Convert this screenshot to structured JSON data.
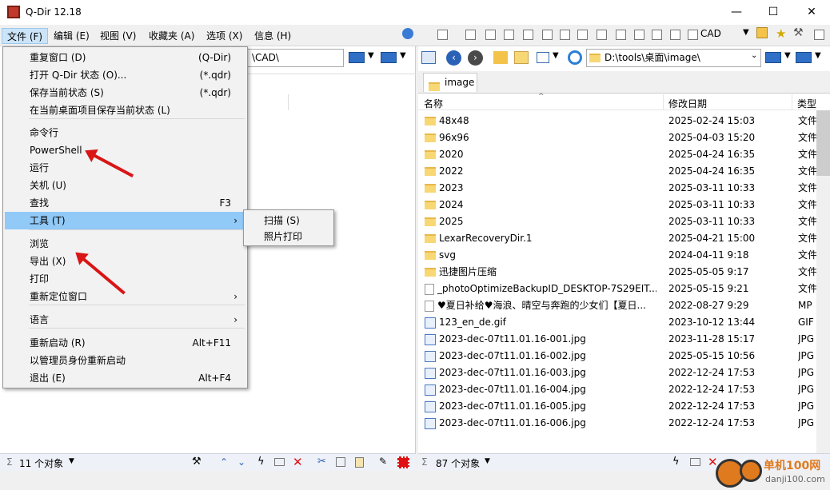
{
  "window": {
    "title": "Q-Dir 12.18",
    "minimize": "—",
    "maximize": "☐",
    "close": "✕"
  },
  "menubar": [
    "文件 (F)",
    "编辑 (E)",
    "视图 (V)",
    "收藏夹 (A)",
    "选项 (X)",
    "信息 (H)"
  ],
  "toolbar": {
    "cad_label": "CAD"
  },
  "left_pane": {
    "address": "\\CAD\\",
    "status": "11 个对象"
  },
  "right_pane": {
    "address": "D:\\tools\\桌面\\image\\",
    "tab": "image",
    "columns": {
      "name": "名称",
      "date": "修改日期",
      "type": "类型"
    },
    "status": "87 个对象",
    "rows": [
      {
        "icon": "folder",
        "name": "48x48",
        "date": "2025-02-24 15:03",
        "type": "文件"
      },
      {
        "icon": "folder",
        "name": "96x96",
        "date": "2025-04-03 15:20",
        "type": "文件"
      },
      {
        "icon": "folder",
        "name": "2020",
        "date": "2025-04-24 16:35",
        "type": "文件"
      },
      {
        "icon": "folder",
        "name": "2022",
        "date": "2025-04-24 16:35",
        "type": "文件"
      },
      {
        "icon": "folder",
        "name": "2023",
        "date": "2025-03-11 10:33",
        "type": "文件"
      },
      {
        "icon": "folder",
        "name": "2024",
        "date": "2025-03-11 10:33",
        "type": "文件"
      },
      {
        "icon": "folder",
        "name": "2025",
        "date": "2025-03-11 10:33",
        "type": "文件"
      },
      {
        "icon": "folder",
        "name": "LexarRecoveryDir.1",
        "date": "2025-04-21 15:00",
        "type": "文件"
      },
      {
        "icon": "folder",
        "name": "svg",
        "date": "2024-04-11 9:18",
        "type": "文件"
      },
      {
        "icon": "folder",
        "name": "迅捷图片压缩",
        "date": "2025-05-05 9:17",
        "type": "文件"
      },
      {
        "icon": "file",
        "name": "_photoOptimizeBackupID_DESKTOP-7S29EIT...",
        "date": "2025-05-15 9:21",
        "type": "文件"
      },
      {
        "icon": "file",
        "name": "♥夏日补给♥海浪、晴空与奔跑的少女们【夏日...",
        "date": "2022-08-27 9:29",
        "type": "MP"
      },
      {
        "icon": "gif",
        "name": "123_en_de.gif",
        "date": "2023-10-12 13:44",
        "type": "GIF"
      },
      {
        "icon": "jpg",
        "name": "2023-dec-07t11.01.16-001.jpg",
        "date": "2023-11-28 15:17",
        "type": "JPG"
      },
      {
        "icon": "jpg",
        "name": "2023-dec-07t11.01.16-002.jpg",
        "date": "2025-05-15 10:56",
        "type": "JPG"
      },
      {
        "icon": "jpg",
        "name": "2023-dec-07t11.01.16-003.jpg",
        "date": "2022-12-24 17:53",
        "type": "JPG"
      },
      {
        "icon": "jpg",
        "name": "2023-dec-07t11.01.16-004.jpg",
        "date": "2022-12-24 17:53",
        "type": "JPG"
      },
      {
        "icon": "jpg",
        "name": "2023-dec-07t11.01.16-005.jpg",
        "date": "2022-12-24 17:53",
        "type": "JPG"
      },
      {
        "icon": "jpg",
        "name": "2023-dec-07t11.01.16-006.jpg",
        "date": "2022-12-24 17:53",
        "type": "JPG"
      }
    ]
  },
  "file_menu": {
    "items": [
      {
        "label": "重复窗口 (D)",
        "shortcut": "(Q-Dir)"
      },
      {
        "label": "打开 Q-Dir 状态 (O)...",
        "shortcut": "(*.qdr)"
      },
      {
        "label": "保存当前状态 (S)",
        "shortcut": "(*.qdr)"
      },
      {
        "label": "在当前桌面项目保存当前状态 (L)",
        "shortcut": ""
      },
      {
        "label": "命令行",
        "shortcut": ""
      },
      {
        "label": "PowerShell",
        "shortcut": ""
      },
      {
        "label": "运行",
        "shortcut": ""
      },
      {
        "label": "关机 (U)",
        "shortcut": ""
      },
      {
        "label": "查找",
        "shortcut": "F3"
      },
      {
        "label": "工具 (T)",
        "shortcut": ""
      },
      {
        "label": "浏览",
        "shortcut": ""
      },
      {
        "label": "导出 (X)",
        "shortcut": ""
      },
      {
        "label": "打印",
        "shortcut": ""
      },
      {
        "label": "重新定位窗口",
        "shortcut": ""
      },
      {
        "label": "语言",
        "shortcut": ""
      },
      {
        "label": "重新启动 (R)",
        "shortcut": "Alt+F11"
      },
      {
        "label": "以管理员身份重新启动",
        "shortcut": ""
      },
      {
        "label": "退出 (E)",
        "shortcut": "Alt+F4"
      }
    ],
    "submenu_arrow": "›"
  },
  "tools_submenu": [
    "扫描 (S)",
    "照片打印"
  ],
  "watermark": {
    "text": "单机100网",
    "url": "danji100.com"
  },
  "colors": {
    "highlight": "#91c9f7",
    "folder": "#f8d775",
    "arrow": "#d91515"
  }
}
